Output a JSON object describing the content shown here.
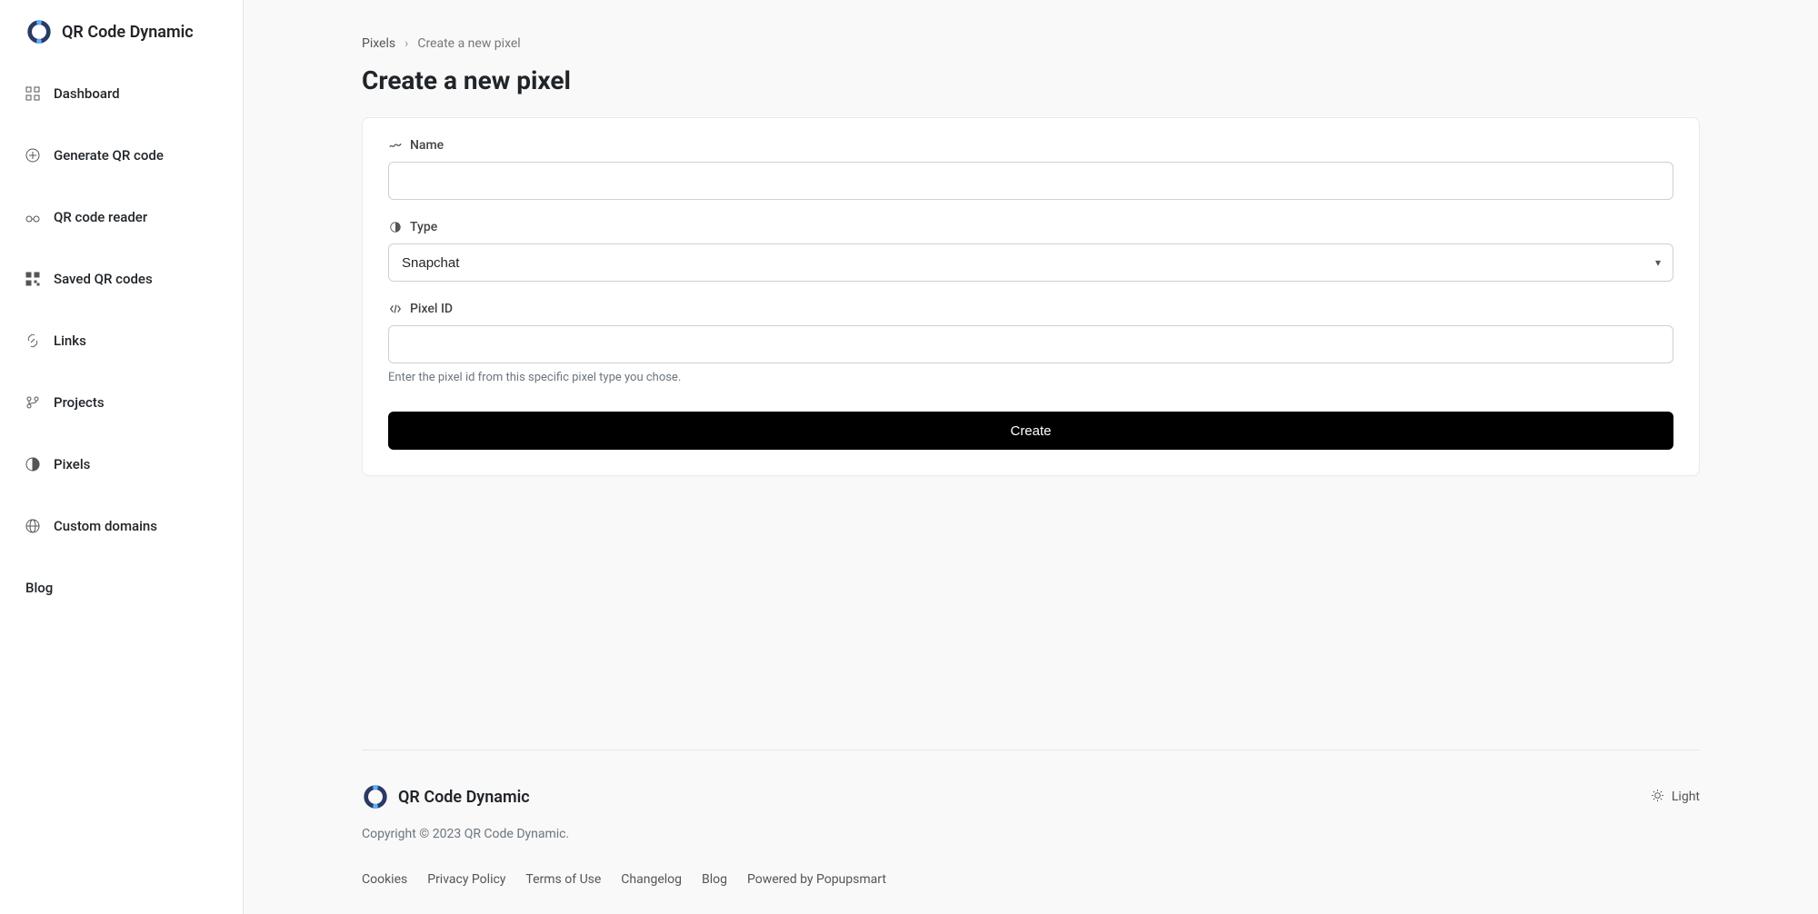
{
  "app_name": "QR Code Dynamic",
  "sidebar": {
    "items": [
      {
        "label": "Dashboard",
        "icon": "grid"
      },
      {
        "label": "Generate QR code",
        "icon": "plus-circle"
      },
      {
        "label": "QR code reader",
        "icon": "glasses"
      },
      {
        "label": "Saved QR codes",
        "icon": "qr"
      },
      {
        "label": "Links",
        "icon": "link"
      },
      {
        "label": "Projects",
        "icon": "branch"
      },
      {
        "label": "Pixels",
        "icon": "half-circle"
      },
      {
        "label": "Custom domains",
        "icon": "globe"
      }
    ],
    "blog_label": "Blog"
  },
  "breadcrumb": {
    "parent": "Pixels",
    "current": "Create a new pixel"
  },
  "page_title": "Create a new pixel",
  "form": {
    "name_label": "Name",
    "name_value": "",
    "type_label": "Type",
    "type_value": "Snapchat",
    "pixel_id_label": "Pixel ID",
    "pixel_id_value": "",
    "pixel_id_helper": "Enter the pixel id from this specific pixel type you chose.",
    "submit_label": "Create"
  },
  "footer": {
    "light_label": "Light",
    "copyright": "Copyright © 2023 QR Code Dynamic.",
    "links": [
      "Cookies",
      "Privacy Policy",
      "Terms of Use",
      "Changelog",
      "Blog",
      "Powered by Popupsmart"
    ]
  }
}
